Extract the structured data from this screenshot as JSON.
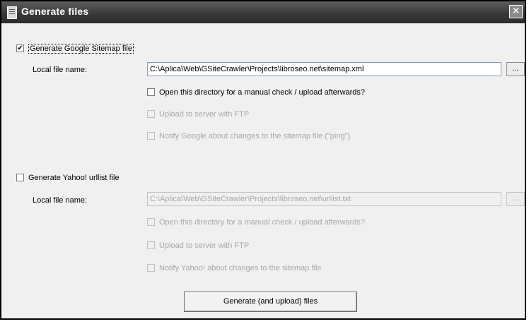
{
  "window": {
    "title": "Generate files",
    "close_glyph": "✕"
  },
  "google": {
    "section_label": "Generate Google Sitemap file",
    "section_checked": true,
    "local_file_label": "Local file name:",
    "local_file_value": "C:\\Aplica\\Web\\GSiteCrawler\\Projects\\libroseo.net\\sitemap.xml",
    "browse_label": "...",
    "open_dir_label": "Open this directory for a manual check / upload afterwards?",
    "ftp_label": "Upload to server with FTP",
    "notify_label": "Notify Google about changes to the sitemap file (\"ping\")"
  },
  "yahoo": {
    "section_label": "Generate Yahoo! urllist file",
    "section_checked": false,
    "local_file_label": "Local file name:",
    "local_file_value": "C:\\Aplica\\Web\\GSiteCrawler\\Projects\\libroseo.net\\urllist.txt",
    "browse_label": "...",
    "open_dir_label": "Open this directory for a manual check / upload afterwards?",
    "ftp_label": "Upload to server with FTP",
    "notify_label": "Notify Yahoo! about changes to the sitemap file"
  },
  "actions": {
    "generate_label": "Generate (and upload) files"
  },
  "check_glyph": "✔"
}
